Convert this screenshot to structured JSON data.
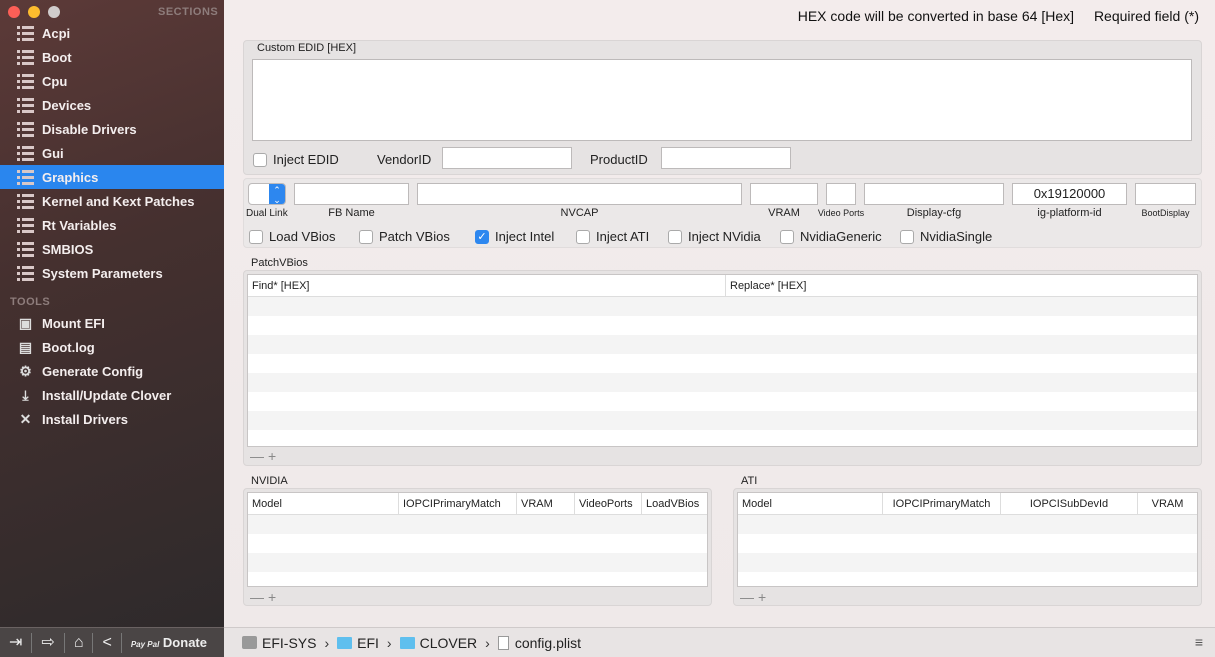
{
  "sidebar": {
    "sections_header": "SECTIONS",
    "sections": [
      "Acpi",
      "Boot",
      "Cpu",
      "Devices",
      "Disable Drivers",
      "Gui",
      "Graphics",
      "Kernel and Kext Patches",
      "Rt Variables",
      "SMBIOS",
      "System Parameters"
    ],
    "selected": "Graphics",
    "tools_header": "TOOLS",
    "tools": [
      {
        "label": "Mount EFI",
        "icon": "disk-icon"
      },
      {
        "label": "Boot.log",
        "icon": "log-icon"
      },
      {
        "label": "Generate Config",
        "icon": "gears-icon"
      },
      {
        "label": "Install/Update Clover",
        "icon": "download-icon"
      },
      {
        "label": "Install Drivers",
        "icon": "tools-icon"
      }
    ],
    "bottom": {
      "paypal": "Pay Pal",
      "donate": "Donate"
    }
  },
  "header": {
    "hex_note": "HEX code will be converted in base 64 [Hex]",
    "required_note": "Required field (*)"
  },
  "edid": {
    "label": "Custom EDID [HEX]",
    "value": "",
    "inject_edid": "Inject EDID",
    "inject_edid_checked": false,
    "vendor_label": "VendorID",
    "vendor_value": "",
    "product_label": "ProductID",
    "product_value": ""
  },
  "fields": {
    "dual_link": "Dual Link",
    "fb_name": "FB Name",
    "nvcap": "NVCAP",
    "vram": "VRAM",
    "video_ports": "Video Ports",
    "display_cfg": "Display-cfg",
    "ig_platform_id": "ig-platform-id",
    "ig_platform_value": "0x19120000",
    "boot_display": "BootDisplay"
  },
  "checks": [
    {
      "label": "Load VBios",
      "checked": false
    },
    {
      "label": "Patch VBios",
      "checked": false
    },
    {
      "label": "Inject Intel",
      "checked": true
    },
    {
      "label": "Inject ATI",
      "checked": false
    },
    {
      "label": "Inject NVidia",
      "checked": false
    },
    {
      "label": "NvidiaGeneric",
      "checked": false
    },
    {
      "label": "NvidiaSingle",
      "checked": false
    }
  ],
  "patchvbios": {
    "label": "PatchVBios",
    "columns": [
      "Find* [HEX]",
      "Replace* [HEX]"
    ]
  },
  "nvidia": {
    "label": "NVIDIA",
    "columns": [
      "Model",
      "IOPCIPrimaryMatch",
      "VRAM",
      "VideoPorts",
      "LoadVBios"
    ]
  },
  "ati": {
    "label": "ATI",
    "columns": [
      "Model",
      "IOPCIPrimaryMatch",
      "IOPCISubDevId",
      "VRAM"
    ]
  },
  "table_controls": {
    "remove": "—",
    "add": "+"
  },
  "path": [
    "EFI-SYS",
    "EFI",
    "CLOVER",
    "config.plist"
  ]
}
